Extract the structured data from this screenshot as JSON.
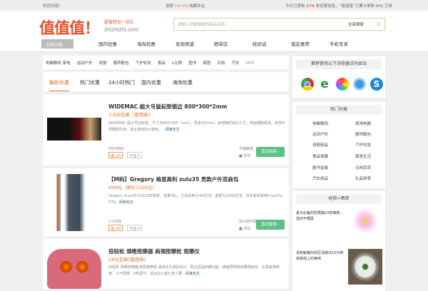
{
  "topbar": {
    "left": "欢迎光临！",
    "mid_pre": "请按",
    "mid_key": "Ctrl+D",
    "mid_post": "收藏本站",
    "right_pre": "今日已更新",
    "right_count": "274",
    "right_mid": "条优惠信息，“值值值”已累计更新",
    "right_total": "901",
    "right_post": "万条"
  },
  "header": {
    "logo": "值值值！",
    "slogan": "超值特价一站汇",
    "domain": "zhizhizhi.com",
    "search_placeholder": "请输入您要搜索的商品名称...",
    "search_scope": "全部搜索"
  },
  "nav": {
    "category": "全部分类",
    "items": [
      "国内优惠",
      "海淘优惠",
      "发现频道",
      "晒单区",
      "经验谈",
      "值友推荐",
      "手机专享"
    ]
  },
  "filters": [
    "电脑数码 家电",
    "运动户外",
    "母婴",
    "服饰鞋包",
    "个护化妆",
    "食品",
    "1元购",
    "图书",
    "家居",
    "日用",
    "汽车",
    "6PM"
  ],
  "tabs": [
    "最新优惠",
    "热门优惠",
    "24小时热门",
    "国内优惠",
    "海淘优惠"
  ],
  "items": [
    {
      "title": "WIDEMAC 超大号鼠标垫锁边 800*300*2mm",
      "price": "3.8元包邮（需用券）",
      "desc": "WIDEMAC 超大号鼠标垫，尺寸为800*300（mm），厚度为2mm，采用精密锁边工艺，表面细腻顺滑，底部天然橡胶防滑，适合游戏办公使用，",
      "more": "阅读全文",
      "time": "59分钟前",
      "vote_up": "值 +0",
      "vote_down": "不值 0",
      "source": "天猫精选",
      "comments": "评论"
    },
    {
      "title": "【M码】Gregory 格里高利 zulu35 男款户外双肩包",
      "price": "699元（原价1259元）",
      "desc": "Gregory Zulu35为2016年新款，容量35L，主体采用210D尼龙，底部为330D尼龙，背负系统采用CrossFlo DTS",
      "more": "阅读全文",
      "time": "1小时前",
      "vote_up": "值 +0",
      "vote_down": "不值 0",
      "source": "亚马逊中国",
      "comments": "评论"
    },
    {
      "title": "倍轻松 颈椎按摩器 肩颈按摩枕 按摩仪",
      "price": "28元包邮(需用券)",
      "desc": "倍轻松 颈椎按摩器 肩颈按摩枕 采用多头揉捏设计，配合恒温热敷功能，缓解颈部肩部腰部疲劳，车载家用两用，小巧便携，9档调节，适合办公室久坐人群",
      "more": "阅读全文"
    }
  ],
  "sidebar": {
    "browser_title": "推荐使用以下浏览器访问本站",
    "browsers": [
      "chrome-icon",
      "ie-icon",
      "360-icon",
      "qq-browser-icon",
      "sogou-icon"
    ],
    "cat_title": "热门分类",
    "cats": [
      "电脑数码",
      "家用电器",
      "运动户外",
      "服饰鞋包",
      "母婴用品",
      "个护化妆",
      "食品保健",
      "家居生活",
      "图书音像",
      "日用百货",
      "汽车用品",
      "礼品钟表"
    ],
    "articles_title": "经验+晒单",
    "articles": [
      "夏日必备的防晒霜10款推荐，选对不晒黑",
      "清热解暑的绿豆汤做法10分钟就能喝上的美味"
    ]
  }
}
